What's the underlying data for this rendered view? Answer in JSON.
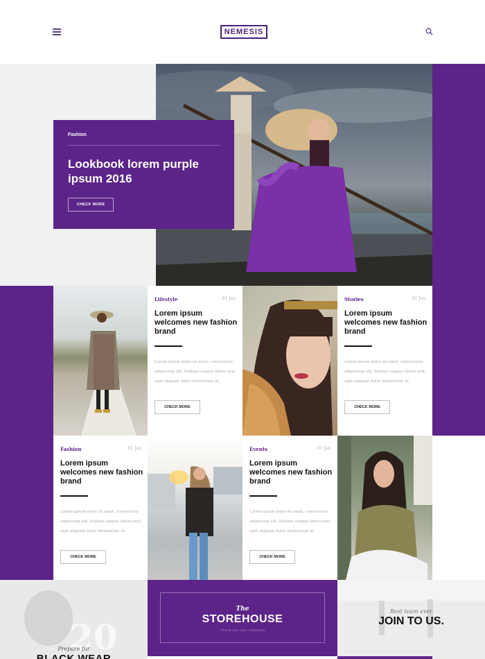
{
  "colors": {
    "accent": "#5c2489",
    "logo": "#4a1f78"
  },
  "header": {
    "logo": "NEMESIS",
    "menu_icon": "hamburger-menu-icon",
    "search_icon": "search-icon"
  },
  "hero": {
    "category": "Fashion",
    "title": "Lookbook lorem purple ipsum 2016",
    "button": "CHECK MORE"
  },
  "cards": [
    {
      "category": "Lifestyle",
      "date": "01 Jan",
      "title": "Lorem ipsum welcomes new fashion brand",
      "body": "Lorem ipsum dolor sit amet, consectetur adipiscing elit. Nullam congue libero erat, eget aliquam dolor fermentum at.",
      "button": "CHECK MORE"
    },
    {
      "category": "Stories",
      "date": "01 Jan",
      "title": "Lorem ipsum welcomes new fashion brand",
      "body": "Lorem ipsum dolor sit amet, consectetur adipiscing elit. Nullam congue libero erat, eget aliquam dolor fermentum at.",
      "button": "CHECK MORE"
    },
    {
      "category": "Fashion",
      "date": "01 Jan",
      "title": "Lorem ipsum welcomes new fashion brand",
      "body": "Lorem ipsum dolor sit amet, consectetur adipiscing elit. Nullam congue libero erat, eget aliquam dolor fermentum at.",
      "button": "CHECK MORE"
    },
    {
      "category": "Events",
      "date": "01 Jan",
      "title": "Lorem ipsum welcomes new fashion brand",
      "body": "Lorem ipsum dolor sit amet, consectetur adipiscing elit. Nullam congue libero erat, eget aliquam dolor fermentum at.",
      "button": "CHECK MORE"
    }
  ],
  "bottom": {
    "left_pre": "Prepare for",
    "left_title": "BLACK WEAR",
    "store_the": "The",
    "store_title": "STOREHOUSE",
    "store_sub": "Check our new collection",
    "right_pre": "Best team ever",
    "right_title": "JOIN TO US."
  }
}
